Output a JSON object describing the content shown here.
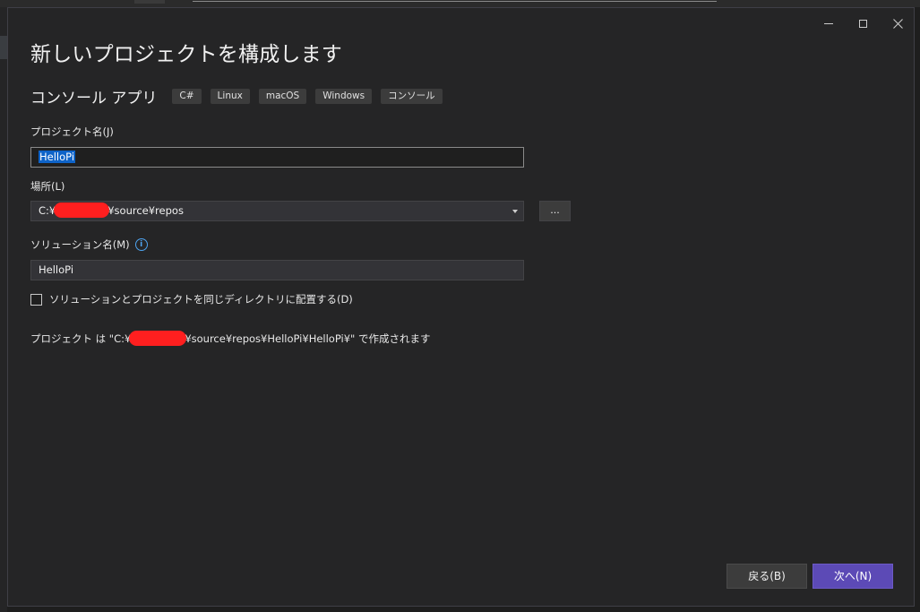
{
  "window": {
    "title": "新しいプロジェクトを構成します"
  },
  "template": {
    "name": "コンソール アプリ",
    "tags": [
      "C#",
      "Linux",
      "macOS",
      "Windows",
      "コンソール"
    ]
  },
  "project_name": {
    "label": "プロジェクト名(J)",
    "value": "HelloPi"
  },
  "location": {
    "label": "場所(L)",
    "value_prefix": "C:¥",
    "value_suffix": "¥source¥repos",
    "browse_label": "..."
  },
  "solution_name": {
    "label": "ソリューション名(M)",
    "value": "HelloPi",
    "info_icon": "info-icon"
  },
  "same_directory": {
    "label": "ソリューションとプロジェクトを同じディレクトリに配置する(D)",
    "checked": false
  },
  "location_note": {
    "prefix": "プロジェクト は \"C:¥",
    "suffix": "¥source¥repos¥HelloPi¥HelloPi¥\" で作成されます"
  },
  "footer": {
    "back_label": "戻る(B)",
    "next_label": "次へ(N)"
  },
  "colors": {
    "accent": "#5c4ab6",
    "selection": "#0e63c8",
    "redaction": "#ff1f1f"
  }
}
